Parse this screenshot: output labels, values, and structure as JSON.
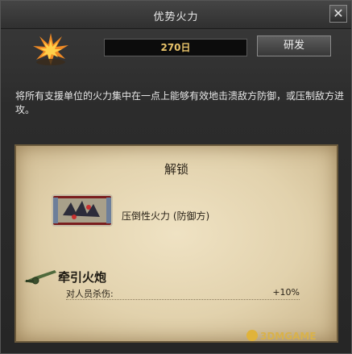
{
  "window": {
    "title": "优势火力",
    "close_symbol": "✕"
  },
  "header": {
    "icon": "explosion-icon",
    "days": "270日",
    "research_label": "研发"
  },
  "description": "将所有支援单位的火力集中在一点上能够有效地击溃敌方防御，或压制敌方进攻。",
  "unlock_panel": {
    "title": "解锁",
    "item": {
      "icon": "suppressive-fire-icon",
      "label": "压倒性火力 (防御方)"
    },
    "unit": {
      "icon": "towed-artillery-icon",
      "name": "牵引火炮",
      "stats": [
        {
          "label": "对人员杀伤:",
          "value": "+10%"
        }
      ]
    }
  },
  "watermark": "3DMGAME",
  "colors": {
    "days_text": "#e8c36a",
    "parchment": "#e2d2ad",
    "window_bg": "#2c2c2c"
  }
}
